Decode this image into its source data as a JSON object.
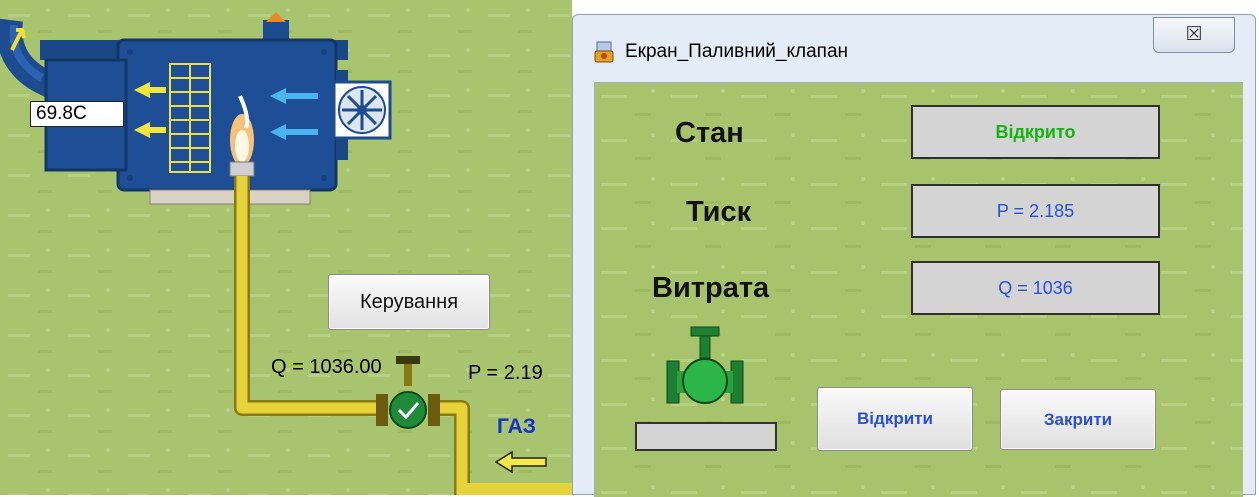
{
  "scada": {
    "temperature_label": "69.8C",
    "control_button_label": "Керування",
    "flow_label": "Q = 1036.00",
    "pressure_label": "P = 2.19",
    "gas_label": "ГАЗ"
  },
  "dialog": {
    "title": "Екран_Паливний_клапан",
    "close_glyph": "☒",
    "state_label": "Стан",
    "state_value": "Відкрито",
    "pressure_label": "Тиск",
    "pressure_value": "P = 2.185",
    "flow_label": "Витрата",
    "flow_value": "Q = 1036",
    "open_button_label": "Відкрити",
    "close_button_label": "Закрити"
  },
  "colors": {
    "panel_green": "#a9c46e",
    "pipe_yellow": "#e6d23a",
    "unit_blue": "#1e4f96",
    "state_open_green": "#14b414",
    "value_blue": "#2b4fd6",
    "gas_label_blue": "#1730d0"
  },
  "icons": {
    "app": "window-app-icon",
    "valve": "valve-icon",
    "gas_arrow": "arrow-left-icon",
    "fan": "fan-icon",
    "flame": "flame-icon"
  }
}
